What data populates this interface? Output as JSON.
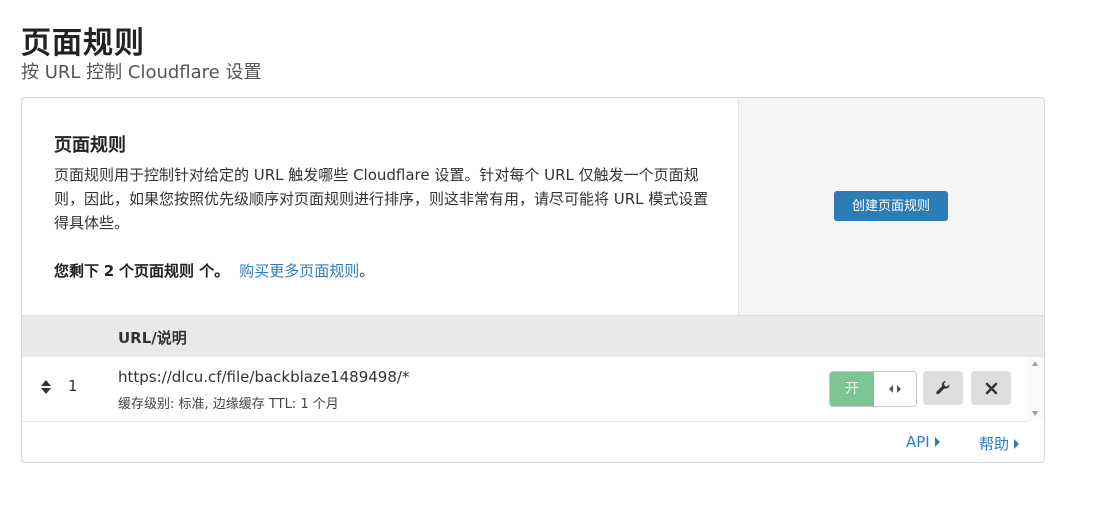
{
  "header": {
    "title": "页面规则",
    "subtitle": "按 URL 控制 Cloudflare 设置"
  },
  "info": {
    "title": "页面规则",
    "description": "页面规则用于控制针对给定的 URL 触发哪些 Cloudflare 设置。针对每个 URL 仅触发一个页面规则，因此，如果您按照优先级顺序对页面规则进行排序，则这非常有用，请尽可能将 URL 模式设置得具体些。",
    "remaining_prefix": "您剩下",
    "remaining_count": "2",
    "remaining_suffix": "个页面规则 个。",
    "buy_more_link": "购买更多页面规则",
    "buy_more_end": "。"
  },
  "actions": {
    "create_button": "创建页面规则"
  },
  "table": {
    "column_header": "URL/说明",
    "rows": [
      {
        "number": "1",
        "url": "https://dlcu.cf/file/backblaze1489498/*",
        "description": "缓存级别: 标准, 边缘缓存 TTL: 1 个月",
        "toggle_label": "开",
        "enabled": true
      }
    ]
  },
  "footer": {
    "api_link": "API",
    "help_link": "帮助"
  },
  "colors": {
    "primary_button": "#2c7cb5",
    "link": "#2f7bbf",
    "toggle_on": "#7cc493"
  },
  "icons": {
    "drag": "sort-arrows-icon",
    "edit": "wrench-icon",
    "delete": "close-icon",
    "toggle_knob": "left-right-arrows-icon",
    "link_arrow": "caret-right-icon"
  }
}
